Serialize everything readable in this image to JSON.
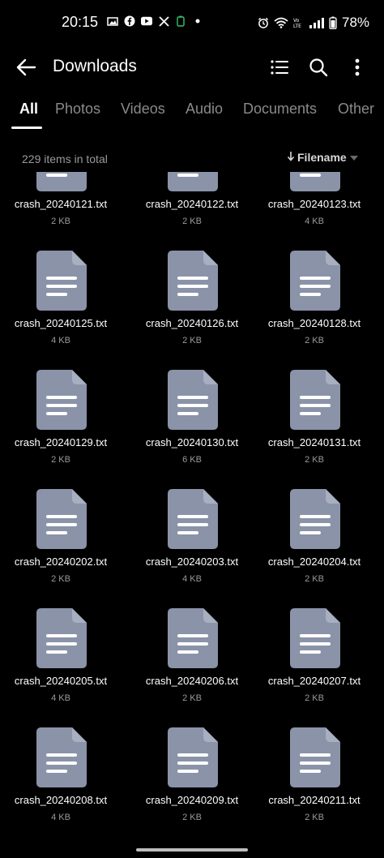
{
  "status_bar": {
    "time": "20:15",
    "battery": "78%",
    "left_icons": [
      "photo-notification-icon",
      "facebook-icon",
      "youtube-icon",
      "x-icon",
      "battery-saver-icon",
      "dot-icon"
    ],
    "right_icons": [
      "alarm-icon",
      "wifi-icon",
      "volte-icon",
      "signal-icon",
      "battery-icon"
    ]
  },
  "app_bar": {
    "title": "Downloads",
    "icons": [
      "back-arrow-icon",
      "list-view-icon",
      "search-icon",
      "more-vert-icon"
    ]
  },
  "tabs": [
    {
      "label": "All",
      "active": true
    },
    {
      "label": "Photos",
      "active": false
    },
    {
      "label": "Videos",
      "active": false
    },
    {
      "label": "Audio",
      "active": false
    },
    {
      "label": "Documents",
      "active": false
    },
    {
      "label": "Other",
      "active": false
    }
  ],
  "summary": {
    "count_text": "229 items in total",
    "sort_label": "Filename",
    "sort_direction_icon": "arrow-down-icon",
    "sort_menu_icon": "caret-down-icon"
  },
  "files": [
    {
      "name": "crash_20240121.txt",
      "size": "2 KB"
    },
    {
      "name": "crash_20240122.txt",
      "size": "2 KB"
    },
    {
      "name": "crash_20240123.txt",
      "size": "4 KB"
    },
    {
      "name": "crash_20240125.txt",
      "size": "4 KB"
    },
    {
      "name": "crash_20240126.txt",
      "size": "2 KB"
    },
    {
      "name": "crash_20240128.txt",
      "size": "2 KB"
    },
    {
      "name": "crash_20240129.txt",
      "size": "2 KB"
    },
    {
      "name": "crash_20240130.txt",
      "size": "6 KB"
    },
    {
      "name": "crash_20240131.txt",
      "size": "2 KB"
    },
    {
      "name": "crash_20240202.txt",
      "size": "2 KB"
    },
    {
      "name": "crash_20240203.txt",
      "size": "4 KB"
    },
    {
      "name": "crash_20240204.txt",
      "size": "2 KB"
    },
    {
      "name": "crash_20240205.txt",
      "size": "4 KB"
    },
    {
      "name": "crash_20240206.txt",
      "size": "2 KB"
    },
    {
      "name": "crash_20240207.txt",
      "size": "2 KB"
    },
    {
      "name": "crash_20240208.txt",
      "size": "4 KB"
    },
    {
      "name": "crash_20240209.txt",
      "size": "2 KB"
    },
    {
      "name": "crash_20240211.txt",
      "size": "2 KB"
    }
  ],
  "file_icon": {
    "name": "text-document-icon",
    "color": "#8a93a8",
    "line_color": "#ffffff"
  },
  "colors": {
    "background": "#000000",
    "active_tab": "#ffffff",
    "inactive_tab": "#8a8a8a"
  }
}
